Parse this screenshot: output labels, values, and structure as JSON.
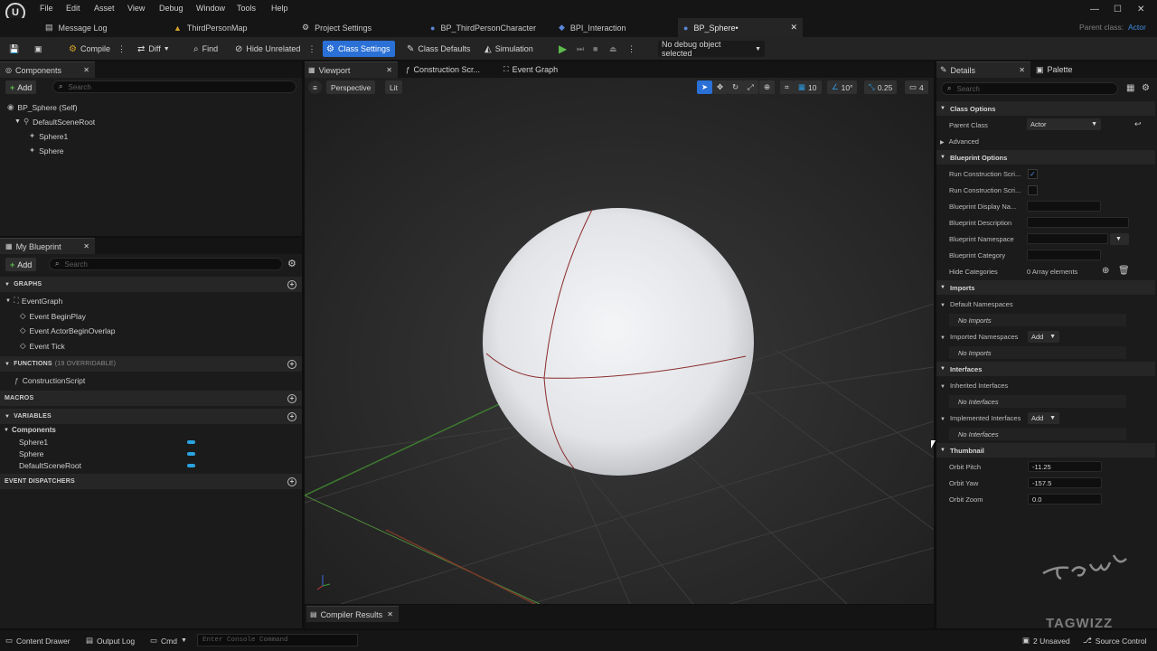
{
  "menu": [
    "File",
    "Edit",
    "Asset",
    "View",
    "Debug",
    "Window",
    "Tools",
    "Help"
  ],
  "window_controls": {
    "minimize": "—",
    "maximize": "☐",
    "close": "✕"
  },
  "tabs": [
    {
      "label": "Message Log"
    },
    {
      "label": "ThirdPersonMap"
    },
    {
      "label": "Project Settings"
    },
    {
      "label": "BP_ThirdPersonCharacter"
    },
    {
      "label": "BPI_Interaction"
    },
    {
      "label": "BP_Sphere•"
    }
  ],
  "parent_class": {
    "label": "Parent class:",
    "value": "Actor"
  },
  "toolbar": {
    "compile": "Compile",
    "diff": "Diff",
    "find": "Find",
    "hide_unrelated": "Hide Unrelated",
    "class_settings": "Class Settings",
    "class_defaults": "Class Defaults",
    "simulation": "Simulation",
    "debug_object": "No debug object selected"
  },
  "components_panel": {
    "title": "Components",
    "add": "Add",
    "search_placeholder": "Search",
    "tree": [
      "BP_Sphere (Self)",
      "DefaultSceneRoot",
      "Sphere1",
      "Sphere"
    ]
  },
  "my_blueprint": {
    "title": "My Blueprint",
    "add": "Add",
    "search_placeholder": "Search",
    "graphs_header": "GRAPHS",
    "graphs": [
      "EventGraph",
      "Event BeginPlay",
      "Event ActorBeginOverlap",
      "Event Tick"
    ],
    "functions_header": "FUNCTIONS",
    "functions_count": "(19 OVERRIDABLE)",
    "functions": [
      "ConstructionScript"
    ],
    "macros_header": "MACROS",
    "variables_header": "VARIABLES",
    "variables_group": "Components",
    "variables": [
      "Sphere1",
      "Sphere",
      "DefaultSceneRoot"
    ],
    "dispatchers_header": "EVENT DISPATCHERS"
  },
  "editor_tabs": [
    "Viewport",
    "Construction Scr...",
    "Event Graph"
  ],
  "viewport": {
    "perspective": "Perspective",
    "lit": "Lit",
    "grid": "10",
    "angle": "10°",
    "scale": "0.25",
    "camera_speed": "4"
  },
  "details": {
    "title": "Details",
    "palette": "Palette",
    "search_placeholder": "Search",
    "class_options": "Class Options",
    "parent_class_label": "Parent Class",
    "parent_class_value": "Actor",
    "advanced": "Advanced",
    "blueprint_options": "Blueprint Options",
    "run_cs1": "Run Construction Scri...",
    "run_cs2": "Run Construction Scri...",
    "display_name": "Blueprint Display Na...",
    "description": "Blueprint Description",
    "namespace": "Blueprint Namespace",
    "category": "Blueprint Category",
    "hide_categories": "Hide Categories",
    "array_elements": "0 Array elements",
    "imports": "Imports",
    "default_namespaces": "Default Namespaces",
    "no_imports": "No Imports",
    "imported_namespaces": "Imported Namespaces",
    "add": "Add",
    "interfaces": "Interfaces",
    "inherited_interfaces": "Inherited Interfaces",
    "no_interfaces": "No Interfaces",
    "implemented_interfaces": "Implemented Interfaces",
    "thumbnail": "Thumbnail",
    "orbit_pitch_label": "Orbit Pitch",
    "orbit_pitch": "-11.25",
    "orbit_yaw_label": "Orbit Yaw",
    "orbit_yaw": "-157.5",
    "orbit_zoom_label": "Orbit Zoom",
    "orbit_zoom": "0.0"
  },
  "compiler_results": "Compiler Results",
  "watermark": "TAGWIZZ",
  "bottom": {
    "content_drawer": "Content Drawer",
    "output_log": "Output Log",
    "cmd": "Cmd",
    "console_placeholder": "Enter Console Command",
    "unsaved": "2 Unsaved",
    "source_control": "Source Control"
  },
  "colors": {
    "accent": "#2a70d6",
    "play": "#5dbb4c",
    "pill": "#2aa3e0",
    "sphere_edge": "#8a2b2b"
  }
}
